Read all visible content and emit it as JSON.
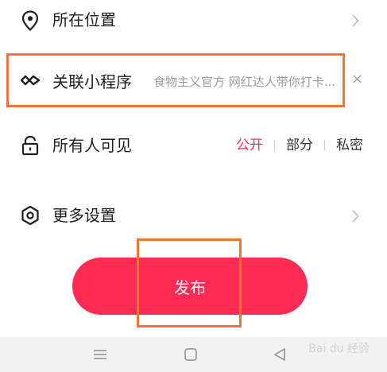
{
  "location": {
    "label": "所在位置",
    "icon": "location-pin-icon"
  },
  "mini_program": {
    "label": "关联小程序",
    "description": "食物主义官方 网红达人带你打卡...",
    "close": "×",
    "icon": "link-icon"
  },
  "visibility": {
    "label": "所有人可见",
    "icon": "lock-icon",
    "options": [
      "公开",
      "部分",
      "私密"
    ],
    "selected": "公开",
    "accent_color": "#fe2c55"
  },
  "more_settings": {
    "label": "更多设置",
    "icon": "hexagon-settings-icon"
  },
  "publish": {
    "label": "发布",
    "color": "#fe2c55"
  },
  "highlight_color": "#f0743a",
  "watermark": "Bai du 经验"
}
